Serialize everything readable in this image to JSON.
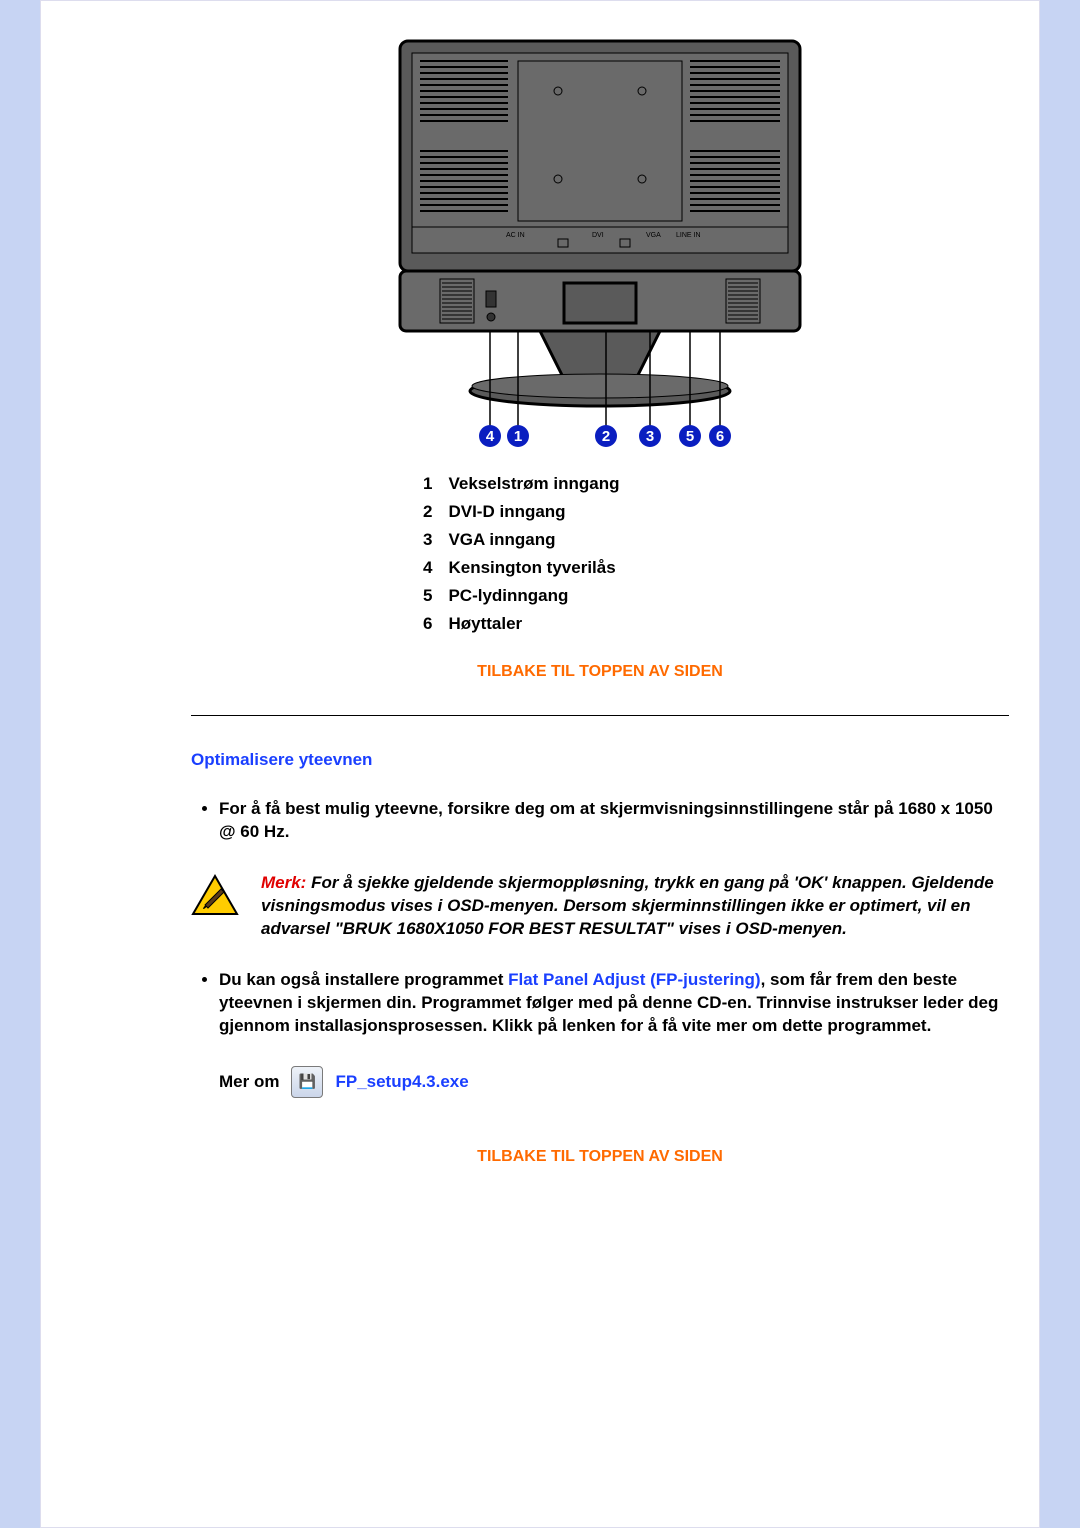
{
  "diagram_labels": {
    "acin": "AC IN",
    "dvi": "DVI",
    "vga": "VGA",
    "linein": "LINE IN"
  },
  "circled": [
    "4",
    "1",
    "2",
    "3",
    "5",
    "6"
  ],
  "ports": [
    {
      "n": "1",
      "label": "Vekselstrøm inngang"
    },
    {
      "n": "2",
      "label": "DVI-D inngang"
    },
    {
      "n": "3",
      "label": "VGA inngang"
    },
    {
      "n": "4",
      "label": "Kensington tyverilås"
    },
    {
      "n": "5",
      "label": "PC-lydinngang"
    },
    {
      "n": "6",
      "label": "Høyttaler"
    }
  ],
  "top_link": "TILBAKE TIL TOPPEN AV SIDEN",
  "section_title": "Optimalisere yteevnen",
  "bullet1": "For å få best mulig yteevne, forsikre deg om at skjermvisningsinnstillingene står på 1680 x 1050 @ 60 Hz.",
  "note_label": "Merk:",
  "note_body": " For å sjekke gjeldende skjermoppløsning, trykk en gang på 'OK' knappen. Gjeldende visningsmodus vises i OSD-menyen. Dersom skjerminnstillingen ikke er optimert, vil en advarsel \"BRUK 1680X1050 FOR BEST RESULTAT\" vises i OSD-menyen.",
  "bullet2_a": "Du kan også installere programmet ",
  "bullet2_link": "Flat Panel Adjust (FP-justering)",
  "bullet2_b": ", som får frem den beste yteevnen i skjermen din. Programmet følger med på denne CD-en. Trinnvise instrukser leder deg gjennom installasjonsprosessen. Klikk på lenken for å få vite mer om dette programmet.",
  "more_about": "Mer om",
  "file_name": "FP_setup4.3.exe"
}
